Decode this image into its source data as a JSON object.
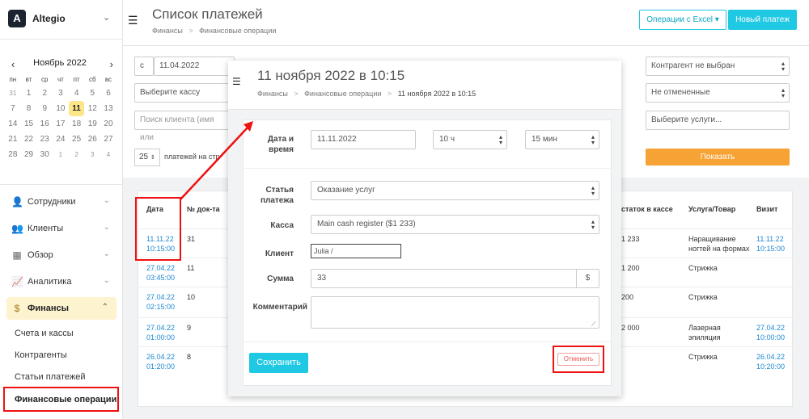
{
  "sidebar": {
    "brand": "Altegio",
    "calendar": {
      "month": "Ноябрь 2022",
      "weekdays": [
        "пн",
        "вт",
        "ср",
        "чт",
        "пт",
        "сб",
        "вс"
      ],
      "weeks": [
        [
          "31",
          "1",
          "2",
          "3",
          "4",
          "5",
          "6"
        ],
        [
          "7",
          "8",
          "9",
          "10",
          "11",
          "12",
          "13"
        ],
        [
          "14",
          "15",
          "16",
          "17",
          "18",
          "19",
          "20"
        ],
        [
          "21",
          "22",
          "23",
          "24",
          "25",
          "26",
          "27"
        ],
        [
          "28",
          "29",
          "30",
          "1",
          "2",
          "3",
          "4"
        ]
      ],
      "today": "11"
    },
    "nav": [
      "Сотрудники",
      "Клиенты",
      "Обзор",
      "Аналитика",
      "Финансы"
    ],
    "sub": [
      "Счета и кассы",
      "Контрагенты",
      "Статьи платежей",
      "Финансовые операции"
    ]
  },
  "header": {
    "title": "Список платежей",
    "breadcrumb": [
      "Финансы",
      "Финансовые операции"
    ],
    "excel_button": "Операции с Excel",
    "new_button": "Новый платеж"
  },
  "filters": {
    "date_prefix": "с",
    "date_from": "11.04.2022",
    "cash_placeholder": "Выберите кассу",
    "client_placeholder": "Поиск клиента (имя или",
    "counterparty": "Контрагент не выбран",
    "cancelled": "Не отмененные",
    "services_placeholder": "Выберите услуги...",
    "per_page": "25",
    "per_page_label": "платежей на стр",
    "show_button": "Показать"
  },
  "table": {
    "headers": [
      "Дата",
      "№ док-та",
      "статок в кассе",
      "Услуга/Товар",
      "Визит"
    ],
    "rows": [
      {
        "date": "11.11.22",
        "time": "10:15:00",
        "doc": "31",
        "balance": "1 233",
        "service1": "Наращивание",
        "service2": "ногтей на формах",
        "visit_date": "11.11.22",
        "visit_time": "10:15:00"
      },
      {
        "date": "27.04.22",
        "time": "03:45:00",
        "doc": "11",
        "balance": "1 200",
        "service1": "Стрижка",
        "service2": "",
        "visit_date": "",
        "visit_time": ""
      },
      {
        "date": "27.04.22",
        "time": "02:15:00",
        "doc": "10",
        "balance": "200",
        "service1": "Стрижка",
        "service2": "",
        "visit_date": "",
        "visit_time": ""
      },
      {
        "date": "27.04.22",
        "time": "01:00:00",
        "doc": "9",
        "balance": "2 000",
        "service1": "Лазерная",
        "service2": "эпиляция",
        "visit_date": "27.04.22",
        "visit_time": "10:00:00"
      },
      {
        "date": "26.04.22",
        "time": "01:20:00",
        "doc": "8",
        "balance": "",
        "service1": "Стрижка",
        "service2": "",
        "visit_date": "26.04.22",
        "visit_time": "10:20:00"
      }
    ]
  },
  "modal": {
    "title": "11 ноября 2022 в 10:15",
    "breadcrumb": [
      "Финансы",
      "Финансовые операции",
      "11 ноября 2022 в 10:15"
    ],
    "labels": {
      "datetime1": "Дата и",
      "datetime2": "время",
      "item1": "Статья",
      "item2": "платежа",
      "cash": "Касса",
      "client": "Клиент",
      "amount": "Сумма",
      "comment": "Комментарий"
    },
    "date": "11.11.2022",
    "hours": "10 ч",
    "minutes": "15 мин",
    "item": "Оказание услуг",
    "cash": "Main cash register ($1 233)",
    "client": "Julia /",
    "amount": "33",
    "currency": "$",
    "comment": "",
    "save": "Сохранить",
    "cancel": "Отменить"
  },
  "colors": {
    "accent": "#1fc8e3",
    "orange": "#f6a234",
    "highlight": "#e11111",
    "active": "#fdf3cf"
  }
}
